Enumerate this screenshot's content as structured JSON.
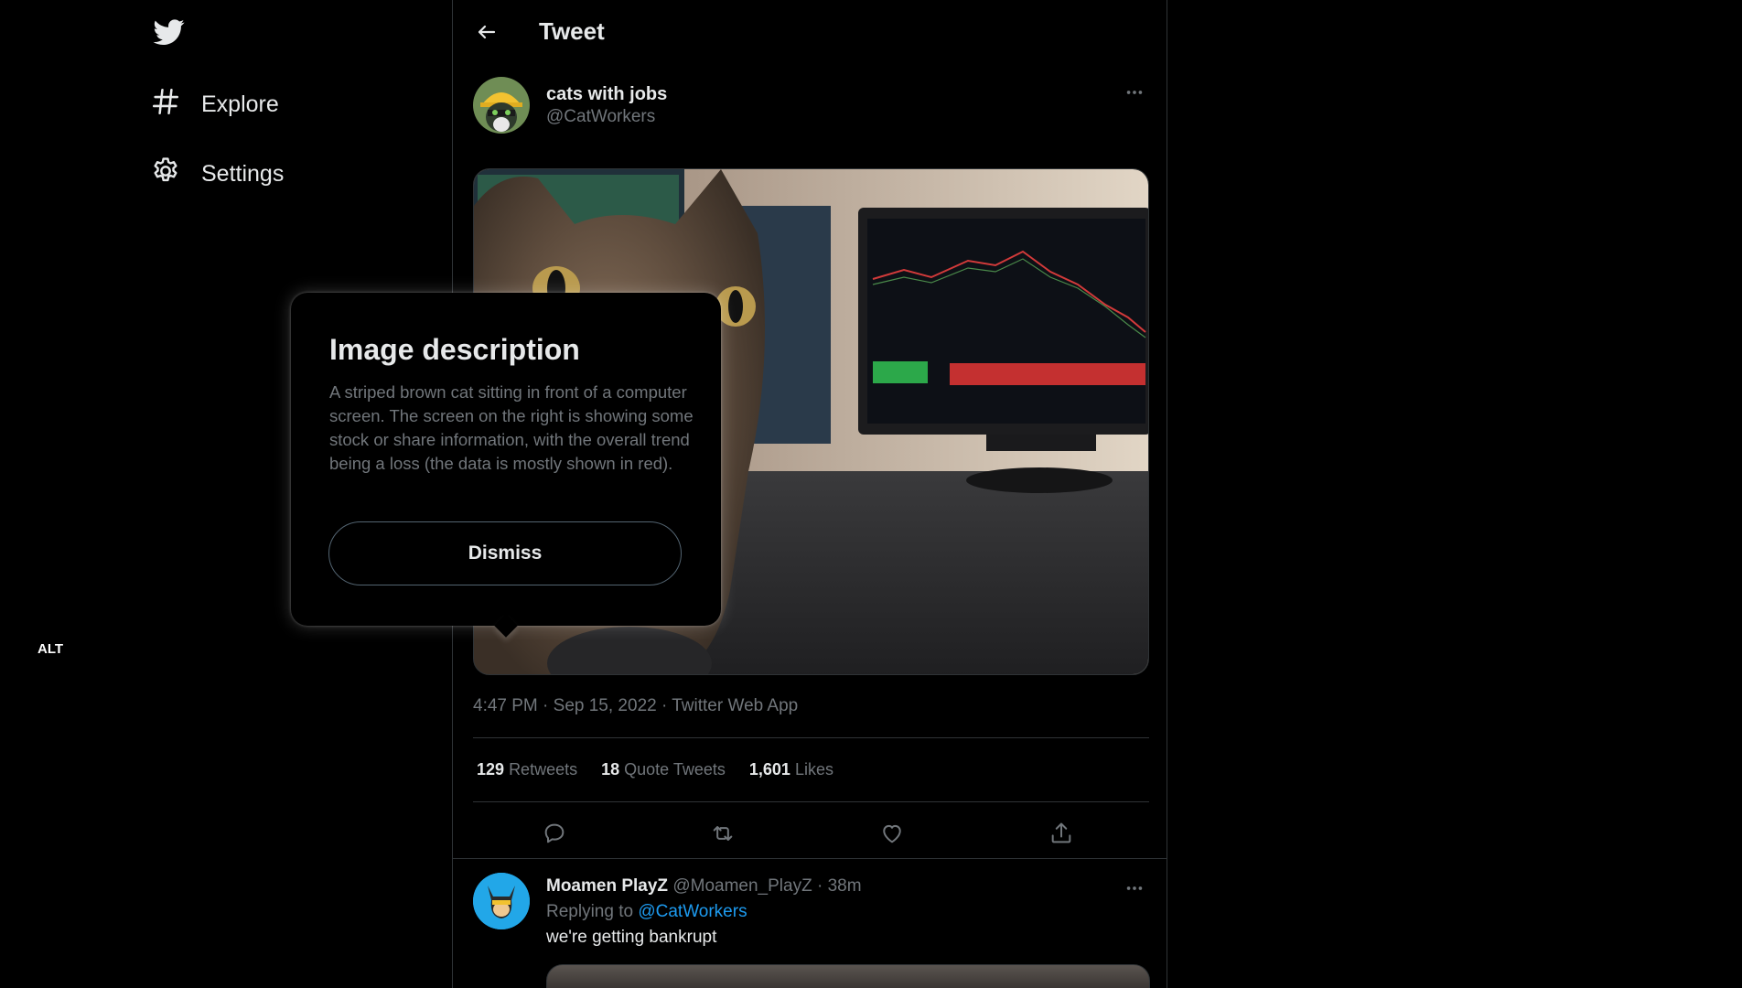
{
  "nav": {
    "logo_icon": "twitter-bird-icon",
    "items": [
      {
        "label": "Explore",
        "icon": "hashtag-icon"
      },
      {
        "label": "Settings",
        "icon": "gear-icon"
      }
    ]
  },
  "header": {
    "title": "Tweet",
    "back_icon": "back-arrow-icon"
  },
  "tweet": {
    "author_name": "cats with jobs",
    "author_handle": "@CatWorkers",
    "alt_badge": "ALT",
    "time": "4:47 PM",
    "date": "Sep 15, 2022",
    "source": "Twitter Web App",
    "stats": {
      "retweets_count": "129",
      "retweets_label": "Retweets",
      "quotes_count": "18",
      "quotes_label": "Quote Tweets",
      "likes_count": "1,601",
      "likes_label": "Likes"
    }
  },
  "popover": {
    "title": "Image description",
    "body": "A striped brown cat sitting in front of a computer screen. The screen on the right is showing some stock or share information, with the overall trend being a loss (the data is mostly shown in red).",
    "dismiss_label": "Dismiss"
  },
  "reply": {
    "name": "Moamen PlayZ",
    "handle": "@Moamen_PlayZ",
    "time": "38m",
    "replying_prefix": "Replying to",
    "replying_handle": "@CatWorkers",
    "text": "we're getting bankrupt"
  },
  "colors": {
    "accent": "#1d9bf0",
    "muted": "#71767b",
    "border": "#2f3336",
    "background": "#000000"
  }
}
